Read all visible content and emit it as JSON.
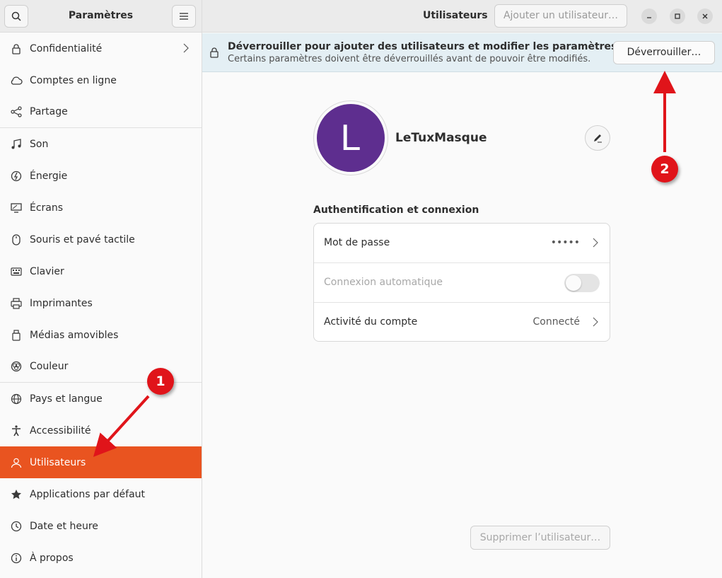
{
  "sidebar": {
    "title": "Paramètres",
    "items": [
      {
        "label": "Confidentialité",
        "icon": "lock-icon"
      },
      {
        "label": "Comptes en ligne",
        "icon": "cloud-icon"
      },
      {
        "label": "Partage",
        "icon": "share-icon"
      },
      {
        "label": "Son",
        "icon": "music-note-icon"
      },
      {
        "label": "Énergie",
        "icon": "power-icon"
      },
      {
        "label": "Écrans",
        "icon": "display-icon"
      },
      {
        "label": "Souris et pavé tactile",
        "icon": "mouse-icon"
      },
      {
        "label": "Clavier",
        "icon": "keyboard-icon"
      },
      {
        "label": "Imprimantes",
        "icon": "printer-icon"
      },
      {
        "label": "Médias amovibles",
        "icon": "usb-icon"
      },
      {
        "label": "Couleur",
        "icon": "color-icon"
      },
      {
        "label": "Pays et langue",
        "icon": "globe-icon"
      },
      {
        "label": "Accessibilité",
        "icon": "accessibility-icon"
      },
      {
        "label": "Utilisateurs",
        "icon": "users-icon"
      },
      {
        "label": "Applications par défaut",
        "icon": "star-icon"
      },
      {
        "label": "Date et heure",
        "icon": "clock-icon"
      },
      {
        "label": "À propos",
        "icon": "info-icon"
      }
    ]
  },
  "header": {
    "title": "Utilisateurs",
    "add_user_label": "Ajouter un utilisateur…"
  },
  "banner": {
    "title": "Déverrouiller pour ajouter des utilisateurs et modifier les paramètres",
    "subtitle": "Certains paramètres doivent être déverrouillés avant de pouvoir être modifiés.",
    "unlock_label": "Déverrouiller…"
  },
  "user": {
    "initial": "L",
    "name": "LeTuxMasque",
    "avatar_color": "#5e2e8f"
  },
  "auth": {
    "section_title": "Authentification et connexion",
    "password_label": "Mot de passe",
    "password_value": "•••••",
    "autologin_label": "Connexion automatique",
    "autologin_enabled": false,
    "activity_label": "Activité du compte",
    "activity_value": "Connecté"
  },
  "delete_label": "Supprimer l’utilisateur…",
  "annotations": {
    "badge1": "1",
    "badge2": "2"
  },
  "colors": {
    "accent": "#e95420",
    "annotation": "#e0141a"
  }
}
